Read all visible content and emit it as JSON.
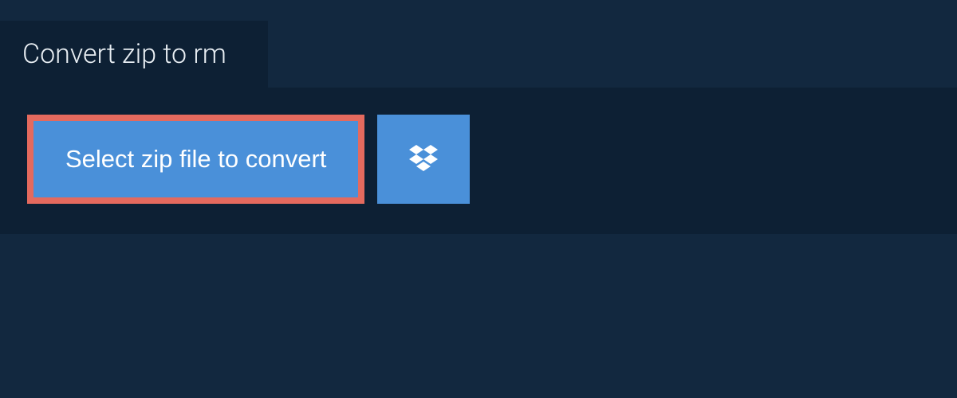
{
  "tab": {
    "title": "Convert zip to rm"
  },
  "upload": {
    "select_label": "Select zip file to convert",
    "dropbox_icon": "dropbox-icon"
  },
  "colors": {
    "background": "#12283f",
    "panel": "#0d2034",
    "button": "#4a90d9",
    "highlight_border": "#e46a5e"
  }
}
